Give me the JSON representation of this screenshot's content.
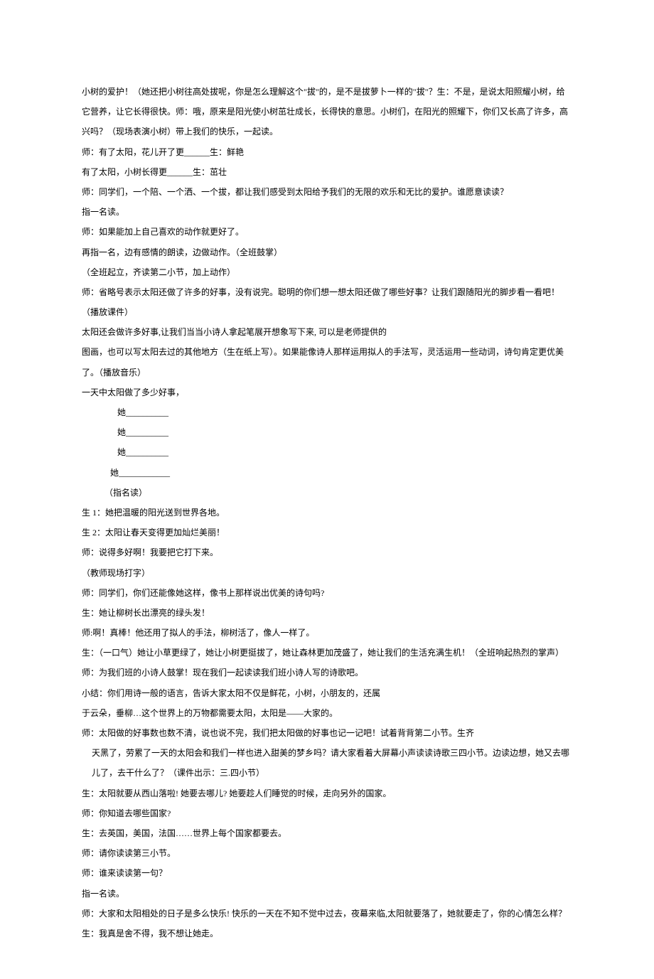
{
  "lines": [
    "小树的爱护！（她还把小树往高处拔呢，你是怎么理解这个\"拔\"的，是不是拔萝卜一样的\"拔\"？生：不是，是说太阳照耀小树，给它营养，让它长得很快。师：哦，原来是阳光使小树茁壮成长，长得快的意思。小树们，在阳光的照耀下，你们又长高了许多，高兴吗？（现场表演小树）带上我们的快乐，一起读。",
    "师：有了太阳，花儿开了更______生：鲜艳",
    "有了太阳，小树长得更______生：茁壮",
    "师：同学们，一个陪、一个洒、一个拔，都让我们感受到太阳给予我们的无限的欢乐和无比的爱护。谁愿意读读？",
    "指一名读。",
    "师：如果能加上自己喜欢的动作就更好了。",
    "再指一名，边有感情的朗读，边做动作。（全班鼓掌）",
    "（全班起立，齐读第二小节，加上动作）",
    "师：省略号表示太阳还做了许多的好事，没有说完。聪明的你们想一想太阳还做了哪些好事？让我们跟随阳光的脚步看一看吧！（播放课件）",
    "太阳还会做许多好事,让我们当当小诗人拿起笔展开想象写下来, 可以是老师提供的",
    "图画，也可以写太阳去过的其他地方（生在纸上写）。如果能像诗人那样运用拟人的手法写，灵活运用一些动词，诗句肯定更优美了。（播放音乐）",
    "一天中太阳做了多少好事，",
    "她__________",
    "她__________",
    "她__________",
    "她____________",
    "（指名读）",
    "生 1：她把温暖的阳光送到世界各地。",
    "生 2：太阳让春天变得更加灿烂美丽！",
    "师：说得多好啊！我要把它打下来。",
    "（教师现场打字）",
    "师：同学们，你们还能像她这样，像书上那样说出优美的诗句吗?",
    "生：她让柳树长出漂亮的绿头发！",
    "师:啊！真棒！他还用了拟人的手法，柳树活了，像人一样了。",
    "生：（一口气）她让小草更绿了，她让小树更挺拔了，她让森林更加茂盛了，她让我们的生活充满生机！（全班响起热烈的掌声）",
    "师：为我们班的小诗人鼓掌！现在我们一起读读我们班小诗人写的诗歌吧。",
    "小结：你们用诗一般的语言，告诉大家太阳不仅是鲜花，小树，小朋友的，还属",
    "于云朵，垂柳…这个世界上的万物都需要太阳，太阳是——大家的。",
    "师：太阳做的好事数也数不清，说也说不完，我们把太阳做的好事也记一记吧！试着背背第二小节。生齐",
    "天黑了，劳累了一天的太阳会和我们一样也进入甜美的梦乡吗？请大家看着大屏幕小声读读诗歌三四小节。边读边想，她又去哪儿了，去干什么了？（课件出示：三.四小节）",
    "生：太阳就要从西山落啦! 她要去哪儿? 她要趁人们睡觉的时候，走向另外的国家。",
    "师：你知道去哪些国家?",
    "生：去英国，美国，法国……世界上每个国家都要去。",
    "师：请你读读第三小节。",
    "师：谁来读读第一句？",
    "指一名读。",
    "师：大家和太阳相处的日子是多么快乐! 快乐的一天在不知不觉中过去，夜幕来临,太阳就要落了，她就要走了，你的心情怎么样？",
    "生：我真是舍不得，我不想让她走。"
  ]
}
